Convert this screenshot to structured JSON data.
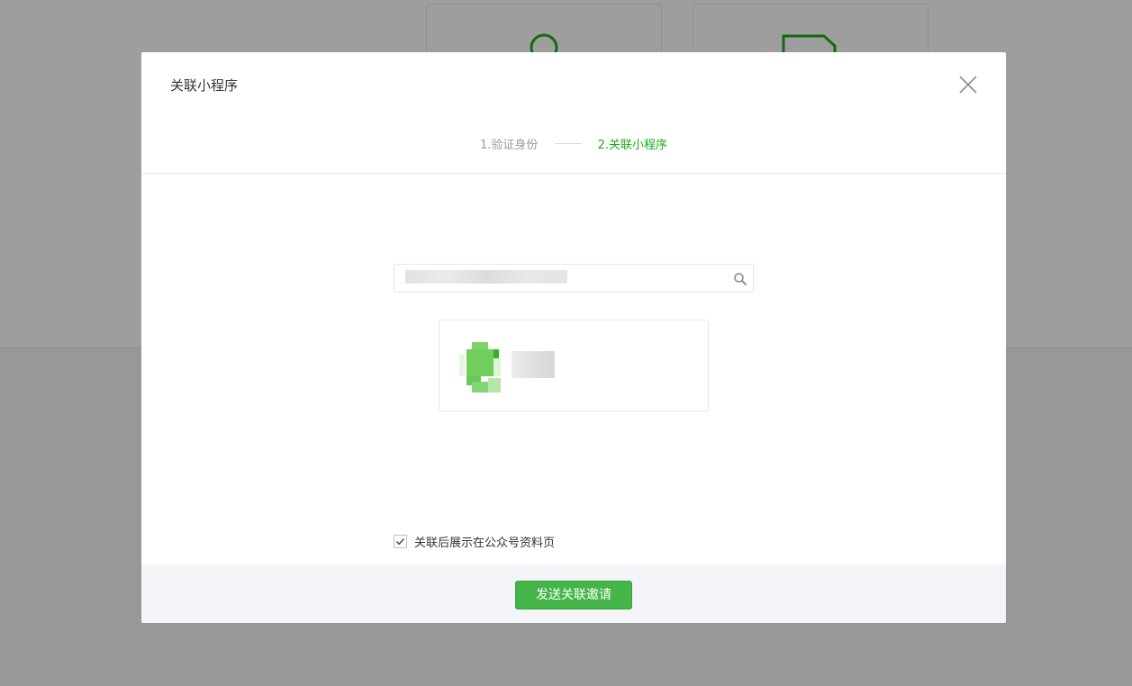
{
  "dialog": {
    "title": "关联小程序",
    "close_icon": "close-icon"
  },
  "steps": [
    {
      "label": "1.验证身份",
      "active": false
    },
    {
      "label": "2.关联小程序",
      "active": true
    }
  ],
  "search": {
    "value": "",
    "placeholder": "",
    "icon": "search-icon"
  },
  "result": {
    "avatar_icon": "mini-program-avatar",
    "name": ""
  },
  "checkbox": {
    "checked": true,
    "label": "关联后展示在公众号资料页"
  },
  "footer": {
    "submit_label": "发送关联邀请"
  },
  "colors": {
    "accent": "#1aad19",
    "button": "#44b549",
    "footer_bg": "#f4f5f9",
    "overlay": "rgba(0,0,0,0.38)"
  }
}
